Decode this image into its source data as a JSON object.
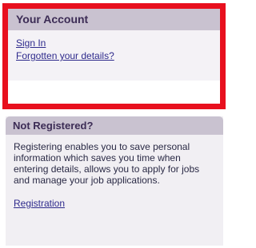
{
  "account": {
    "title": "Your Account",
    "sign_in": "Sign In",
    "forgotten": "Forgotten your details?"
  },
  "register": {
    "title": "Not Registered?",
    "description": "Registering enables you to save personal information which saves you time when entering details, allows you to apply for jobs and manage your job applications.",
    "link": "Registration"
  },
  "colors": {
    "selection_outline": "#e8101e",
    "header_bg": "#c9c2d0",
    "link": "#2e2a8c"
  }
}
